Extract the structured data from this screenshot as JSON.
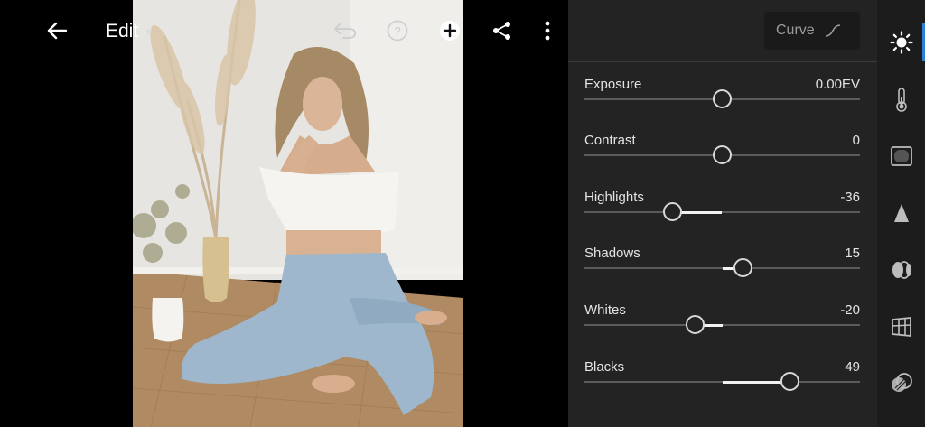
{
  "topbar": {
    "back_icon": "arrow-left-icon",
    "edit_label": "Edit",
    "undo_icon": "undo-icon",
    "help_icon": "help-icon",
    "add_icon": "add-icon",
    "share_icon": "share-icon",
    "more_icon": "more-vertical-icon"
  },
  "panel": {
    "curve_label": "Curve",
    "sliders": [
      {
        "label": "Exposure",
        "value": "0.00EV",
        "position": 0.5
      },
      {
        "label": "Contrast",
        "value": "0",
        "position": 0.5
      },
      {
        "label": "Highlights",
        "value": "-36",
        "position": 0.32
      },
      {
        "label": "Shadows",
        "value": "15",
        "position": 0.575
      },
      {
        "label": "Whites",
        "value": "-20",
        "position": 0.4
      },
      {
        "label": "Blacks",
        "value": "49",
        "position": 0.745
      }
    ]
  },
  "rail": {
    "active_color": "#2d7fd8",
    "items": [
      "light-icon",
      "color-temperature-icon",
      "effects-icon",
      "detail-icon",
      "optics-icon",
      "geometry-icon",
      "color-mix-icon"
    ]
  }
}
